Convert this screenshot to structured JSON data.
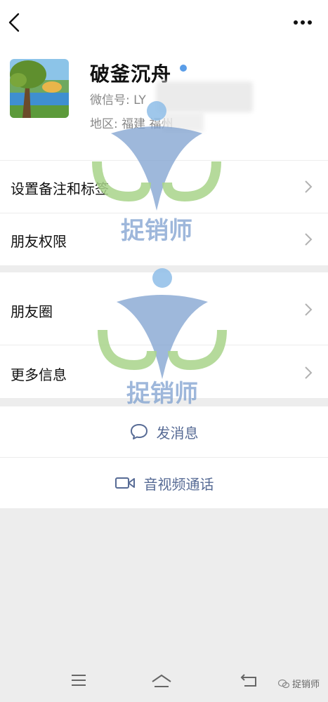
{
  "profile": {
    "name": "破釜沉舟",
    "wechat_id_label": "微信号: LY",
    "region_label": "地区:",
    "region_province": "福建",
    "region_city": "福州"
  },
  "menu_group_1": [
    {
      "label": "设置备注和标签"
    },
    {
      "label": "朋友权限"
    }
  ],
  "menu_group_2": [
    {
      "label": "朋友圈"
    },
    {
      "label": "更多信息"
    }
  ],
  "actions": {
    "message": "发消息",
    "video_call": "音视频通话"
  },
  "watermark": {
    "text": "捉销师"
  },
  "brand_tag": "捉销师",
  "colors": {
    "link": "#576b95",
    "watermark_blue": "#7ea0cf",
    "watermark_green": "#a8d38a"
  }
}
